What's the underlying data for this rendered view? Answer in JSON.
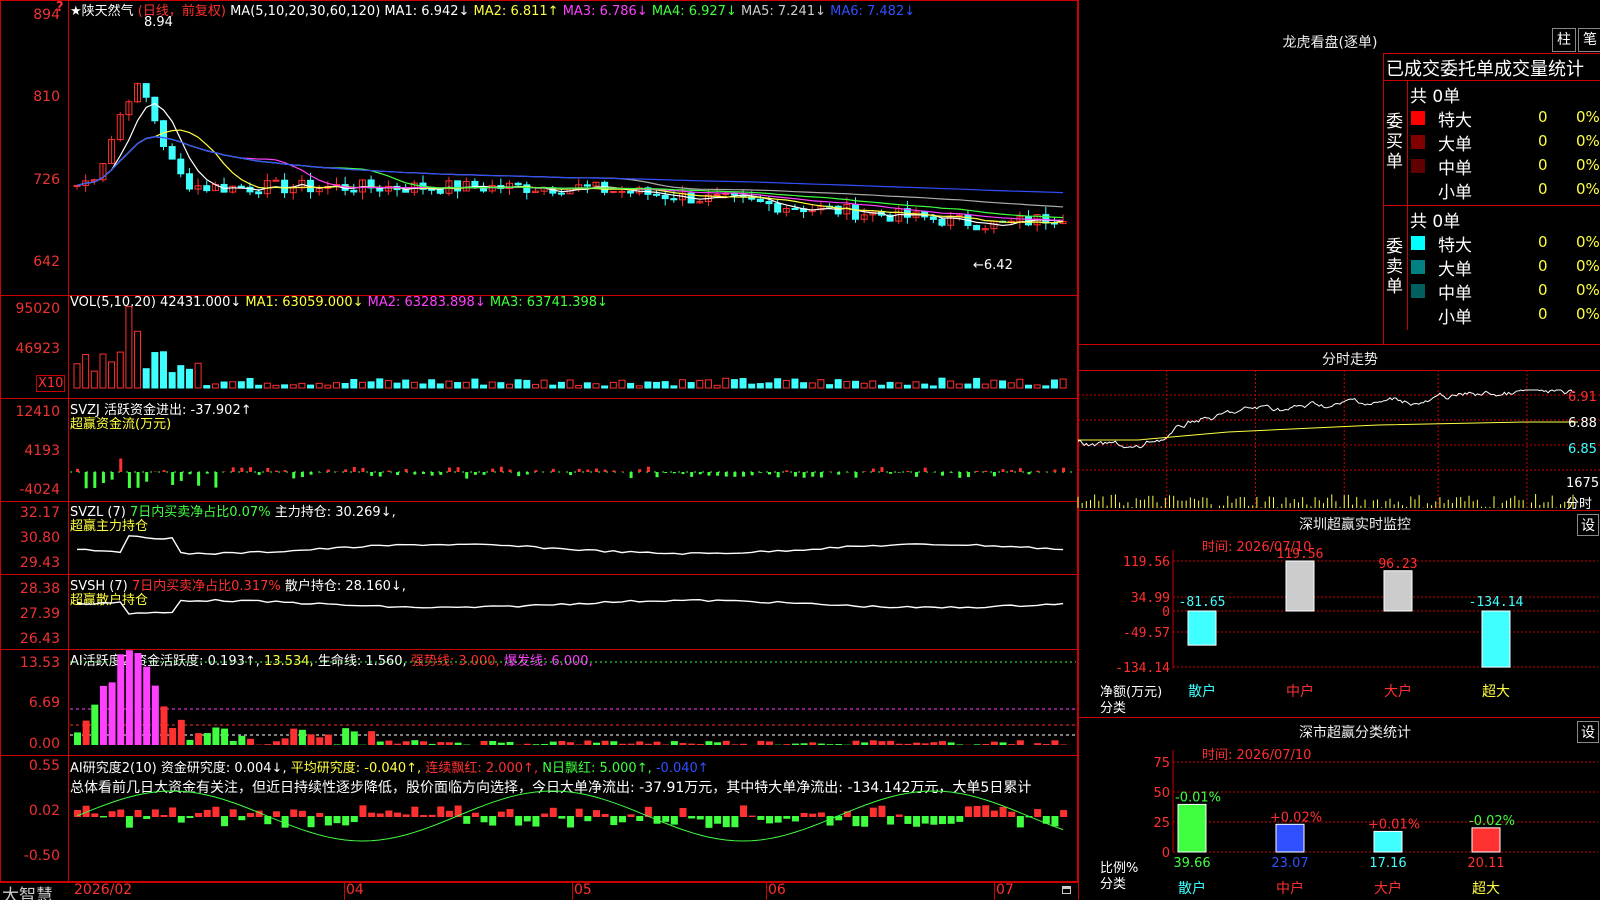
{
  "stock": {
    "name_line": "★陕天然气",
    "period": "(日线，前复权)",
    "ma_params": "MA(5,10,20,30,60,120)",
    "ma": [
      {
        "label": "MA1: 6.942↓",
        "color": "#ffffff"
      },
      {
        "label": "MA2: 6.811↑",
        "color": "#ffff40"
      },
      {
        "label": "MA3: 6.786↓",
        "color": "#ff40ff"
      },
      {
        "label": "MA4: 6.927↓",
        "color": "#40ff40"
      },
      {
        "label": "MA5: 7.241↓",
        "color": "#cccccc"
      },
      {
        "label": "MA6: 7.482↓",
        "color": "#3050ff"
      }
    ],
    "price_ticks": [
      "894",
      "810",
      "726",
      "642"
    ],
    "high_label": "8.94",
    "low_label": "←6.42",
    "corner_mark": "?"
  },
  "volume": {
    "header": "VOL(5,10,20)",
    "value": "42431.000↓",
    "ma1": "MA1: 63059.000↓",
    "ma2": "MA2: 63283.898↓",
    "ma3": "MA3: 63741.398↓",
    "ticks": [
      "95020",
      "46923"
    ],
    "scale": "X10"
  },
  "svzj": {
    "header": "SVZJ",
    "value": "活跃资金进出: -37.902↑",
    "sub": "超赢资金流(万元)",
    "ticks": [
      "12410",
      "4193",
      "-4024"
    ]
  },
  "svzl": {
    "header": "SVZL (7)",
    "note": "7日内买卖净占比0.07%",
    "value": "主力持仓: 30.269↓,",
    "sub": "超赢主力持仓",
    "ticks": [
      "32.17",
      "30.80",
      "29.43"
    ]
  },
  "svsh": {
    "header": "SVSH (7)",
    "note": "7日内买卖净占比0.317%",
    "value": "散户持仓: 28.160↓,",
    "sub": "超赢散户持仓",
    "ticks": [
      "28.38",
      "27.39",
      "26.43"
    ]
  },
  "ai_active": {
    "header": "AI活跃度2",
    "value": "资金活跃度: 0.193↑,",
    "v2": "13.534,",
    "v3": "生命线: 1.560,",
    "v4": "强势线: 3.000,",
    "v5": "爆发线: 6.000,",
    "ticks": [
      "13.53",
      "6.69",
      "0.00"
    ]
  },
  "ai_research": {
    "header": "AI研究度2(10)",
    "value": "资金研究度: 0.004↓,",
    "v2": "平均研究度: -0.040↑,",
    "v3": "连续飘红: 2.000↑,",
    "v4": "N日飘红: 5.000↑,",
    "v5": "-0.040↑",
    "summary": "总体看前几日大资金有关注，但近日持续性逐步降低，股价面临方向选择，今日大单净流出: -37.91万元，其中特大单净流出: -134.142万元，大单5日累计",
    "ticks": [
      "0.55",
      "0.02",
      "-0.50"
    ]
  },
  "xaxis": {
    "brand": "大智慧",
    "labels": [
      "2026/02",
      "04",
      "05",
      "06",
      "07"
    ]
  },
  "right": {
    "lhb_title": "龙虎看盘(逐单)",
    "tab_zhu": "柱",
    "tab_bi": "笔",
    "order_title": "已成交委托单成交量统计",
    "buy": {
      "label": "委买单",
      "total": "共 0单",
      "rows": [
        {
          "name": "特大",
          "count": "0",
          "pct": "0%",
          "color": "#ff0000"
        },
        {
          "name": "大单",
          "count": "0",
          "pct": "0%",
          "color": "#800000"
        },
        {
          "name": "中单",
          "count": "0",
          "pct": "0%",
          "color": "#600000"
        },
        {
          "name": "小单",
          "count": "0",
          "pct": "0%",
          "color": "#000000"
        }
      ]
    },
    "sell": {
      "label": "委卖单",
      "total": "共 0单",
      "rows": [
        {
          "name": "特大",
          "count": "0",
          "pct": "0%",
          "color": "#00ffff"
        },
        {
          "name": "大单",
          "count": "0",
          "pct": "0%",
          "color": "#008080"
        },
        {
          "name": "中单",
          "count": "0",
          "pct": "0%",
          "color": "#006060"
        },
        {
          "name": "小单",
          "count": "0",
          "pct": "0%",
          "color": "#000000"
        }
      ]
    },
    "intraday_title": "分时走势",
    "intraday_ticks": [
      "6.91",
      "6.88",
      "6.85"
    ],
    "intraday_vol": "1675",
    "intraday_vol_label": "分时",
    "monitor_title": "深圳超赢实时监控",
    "monitor_time": "时间: 2026/07/10",
    "monitor_set": "设",
    "monitor_ticks": [
      "119.56",
      "34.99",
      "0",
      "-49.57",
      "-134.14"
    ],
    "monitor_ylabel": "净额(万元)",
    "monitor_xlabel": "分类",
    "monitor_bars": [
      {
        "cat": "散户",
        "value": "-81.65"
      },
      {
        "cat": "中户",
        "value": "119.56"
      },
      {
        "cat": "大户",
        "value": "96.23"
      },
      {
        "cat": "超大",
        "value": "-134.14"
      }
    ],
    "stats_title": "深市超赢分类统计",
    "stats_time": "时间: 2026/07/10",
    "stats_set": "设",
    "stats_ticks": [
      "75",
      "50",
      "25",
      "0"
    ],
    "stats_ylabel": "比例%",
    "stats_xlabel": "分类",
    "stats_bars": [
      {
        "cat": "散户",
        "value": "39.66",
        "delta": "-0.01%"
      },
      {
        "cat": "中户",
        "value": "23.07",
        "delta": "+0.02%"
      },
      {
        "cat": "大户",
        "value": "17.16",
        "delta": "+0.01%"
      },
      {
        "cat": "超大",
        "value": "20.11",
        "delta": "-0.02%"
      }
    ]
  }
}
